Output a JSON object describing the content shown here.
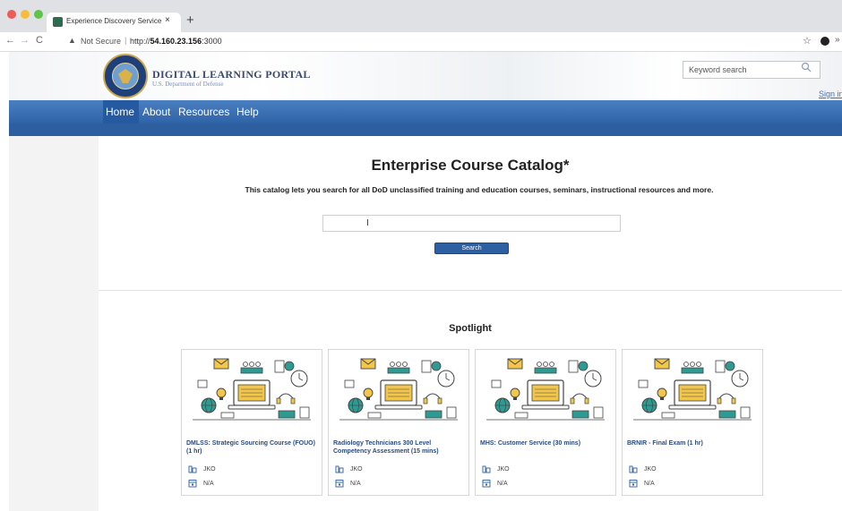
{
  "browser": {
    "tab_title": "Experience Discovery Service",
    "tab_close": "×",
    "new_tab": "+",
    "not_secure": "Not Secure",
    "url_prefix": "http://",
    "url_host": "54.160.23.156",
    "url_port": ":3000"
  },
  "header": {
    "title": "DIGITAL LEARNING PORTAL",
    "subtitle": "U.S. Department of Defense",
    "search_placeholder": "Keyword search",
    "sign_in": "Sign in"
  },
  "nav": {
    "items": [
      "Home",
      "About",
      "Resources",
      "Help"
    ]
  },
  "main": {
    "title": "Enterprise Course Catalog*",
    "description": "This catalog lets you search for all DoD unclassified training and education courses, seminars, instructional resources and more.",
    "search_button": "Search",
    "spotlight_title": "Spotlight"
  },
  "cards": [
    {
      "title": "DMLSS: Strategic Sourcing Course (FOUO) (1 hr)",
      "provider": "JKO",
      "extra": "N/A"
    },
    {
      "title": "Radiology Technicians 300 Level Competency Assessment (15 mins)",
      "provider": "JKO",
      "extra": "N/A"
    },
    {
      "title": "MHS: Customer Service (30 mins)",
      "provider": "JKO",
      "extra": "N/A"
    },
    {
      "title": "BRNIR - Final Exam (1 hr)",
      "provider": "JKO",
      "extra": "N/A"
    }
  ],
  "colors": {
    "nav_blue": "#2f63a8",
    "link_blue": "#2b4b80",
    "illustration_teal": "#2e9b93",
    "illustration_yellow": "#f2c64a"
  }
}
